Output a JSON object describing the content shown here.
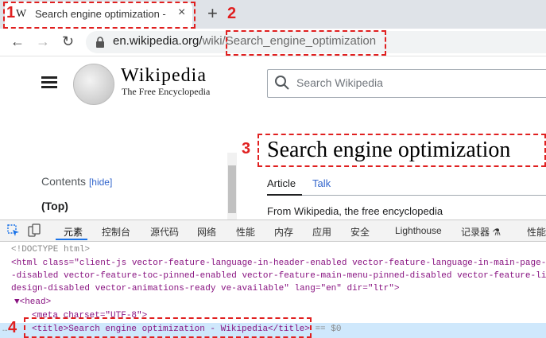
{
  "browser": {
    "tab_favicon": "W",
    "tab_title": "Search engine optimization - W",
    "close_glyph": "×",
    "new_tab_glyph": "+",
    "url_domain": "en.wikipedia.org/",
    "url_path": "wiki/Search_engine_optimization",
    "nav_back": "←",
    "nav_forward": "→",
    "nav_reload": "↻"
  },
  "wiki": {
    "wordmark": "Wikipedia",
    "tagline": "The Free Encyclopedia",
    "search_placeholder": "Search Wikipedia",
    "heading": "Search engine optimization",
    "toc_title": "Contents",
    "toc_hide": "[hide]",
    "toc_top": "(Top)",
    "tab_article": "Article",
    "tab_talk": "Talk",
    "from_line": "From Wikipedia, the free encyclopedia"
  },
  "devtools": {
    "tabs": [
      "元素",
      "控制台",
      "源代码",
      "网络",
      "性能",
      "内存",
      "应用",
      "安全",
      "Lighthouse",
      "记录器 ⚗",
      "性能"
    ],
    "code": {
      "doctype": "<!DOCTYPE html>",
      "html_open_1": "<html class=\"client-js vector-feature-language-in-header-enabled vector-feature-language-in-main-page-",
      "html_open_2": "-disabled vector-feature-toc-pinned-enabled vector-feature-main-menu-pinned-disabled vector-feature-li",
      "html_open_3": "design-disabled vector-animations-ready ve-available\" lang=\"en\" dir=\"ltr\">",
      "head_open": "▼<head>",
      "meta": "<meta charset=\"UTF-8\">",
      "title_line": "<title>Search engine optimization - Wikipedia</title>",
      "title_suffix": " == $0",
      "ellipsis": "…"
    }
  },
  "annotations": [
    "1",
    "2",
    "3",
    "4"
  ],
  "colors": {
    "annotation": "#e02020",
    "link": "#3366cc",
    "selection": "#cfe8fc"
  }
}
